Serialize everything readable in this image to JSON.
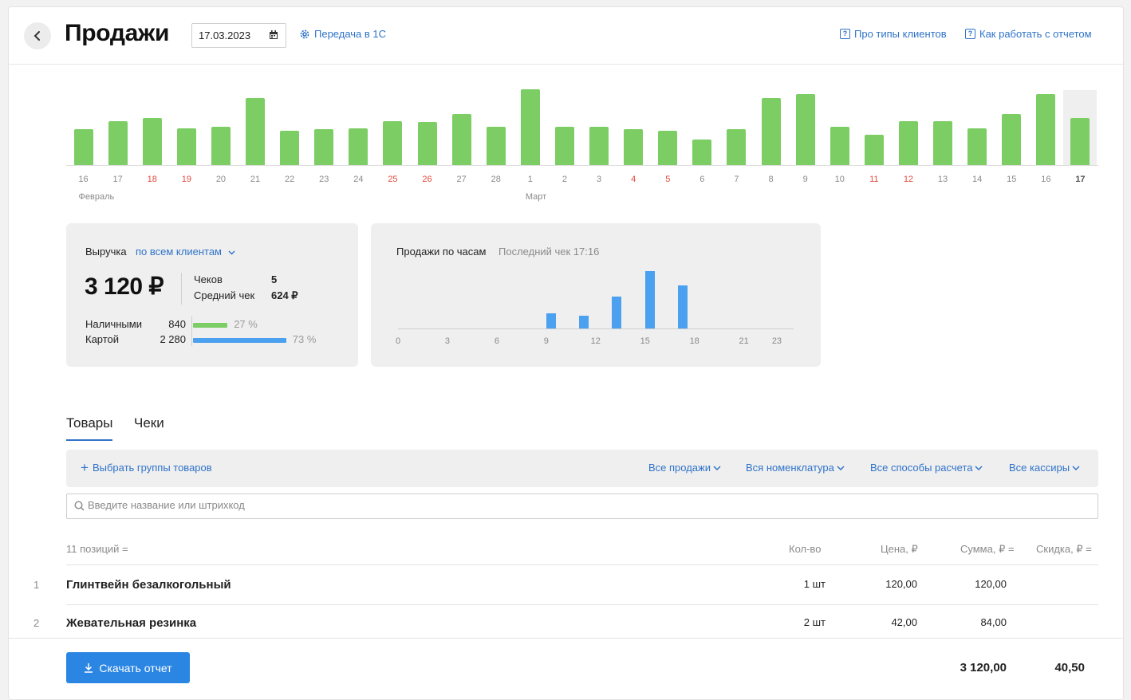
{
  "header": {
    "title": "Продажи",
    "date": "17.03.2023",
    "transfer_link": "Передача в 1С",
    "help_client_types": "Про типы клиентов",
    "help_report": "Как работать с отчетом"
  },
  "day_chart": {
    "chart_data": {
      "type": "bar",
      "categories": [
        "16",
        "17",
        "18",
        "19",
        "20",
        "21",
        "22",
        "23",
        "24",
        "25",
        "26",
        "27",
        "28",
        "1",
        "2",
        "3",
        "4",
        "5",
        "6",
        "7",
        "8",
        "9",
        "10",
        "11",
        "12",
        "13",
        "14",
        "15",
        "16",
        "17"
      ],
      "values": [
        45,
        55,
        59,
        46,
        48,
        84,
        43,
        45,
        46,
        55,
        54,
        64,
        48,
        95,
        48,
        48,
        45,
        43,
        32,
        45,
        84,
        89,
        48,
        38,
        55,
        55,
        46,
        64,
        89,
        59
      ],
      "weekend_flags": [
        false,
        false,
        true,
        true,
        false,
        false,
        false,
        false,
        false,
        true,
        true,
        false,
        false,
        false,
        false,
        false,
        true,
        true,
        false,
        false,
        false,
        false,
        false,
        true,
        true,
        false,
        false,
        false,
        false,
        false
      ],
      "selected_index": 29,
      "months": [
        {
          "label": "Февраль",
          "start_index": 0
        },
        {
          "label": "Март",
          "start_index": 13
        }
      ],
      "bar_color": "#7ccd63",
      "weekend_color": "#e24a3b"
    }
  },
  "revenue": {
    "label": "Выручка",
    "filter": "по всем клиентам",
    "total": "3 120 ₽",
    "checks_label": "Чеков",
    "checks_value": "5",
    "avg_label": "Средний чек",
    "avg_value": "624 ₽",
    "payments": [
      {
        "name": "Наличными",
        "amount": "840",
        "percent": "27 %",
        "fraction": 0.27,
        "color": "#7ccd63"
      },
      {
        "name": "Картой",
        "amount": "2 280",
        "percent": "73 %",
        "fraction": 0.73,
        "color": "#4ba0f0"
      }
    ]
  },
  "hourly": {
    "title": "Продажи по часам",
    "last_check": "Последний чек 17:16",
    "chart_data": {
      "type": "bar",
      "x_ticks": [
        "0",
        "3",
        "6",
        "9",
        "12",
        "15",
        "18",
        "21",
        "23"
      ],
      "hours": [
        9,
        11,
        13,
        15,
        17
      ],
      "values": [
        27,
        22,
        55,
        100,
        75
      ],
      "bar_color": "#4ba0f0"
    }
  },
  "tabs": [
    {
      "label": "Товары",
      "active": true
    },
    {
      "label": "Чеки",
      "active": false
    }
  ],
  "filters": {
    "add_group": "Выбрать группы товаров",
    "all_sales": "Все продажи",
    "all_nomenclature": "Вся номенклатура",
    "all_payment_methods": "Все способы расчета",
    "all_cashiers": "Все кассиры"
  },
  "search": {
    "placeholder": "Введите название или штрихкод"
  },
  "table": {
    "headers": {
      "positions": "11 позиций",
      "qty": "Кол-во",
      "price": "Цена, ₽",
      "sum": "Сумма, ₽",
      "discount": "Скидка, ₽"
    },
    "rows": [
      {
        "num": "1",
        "name": "Глинтвейн безалкогольный",
        "qty": "1 шт",
        "price": "120,00",
        "sum": "120,00",
        "discount": ""
      },
      {
        "num": "2",
        "name": "Жевательная резинка",
        "qty": "2 шт",
        "price": "42,00",
        "sum": "84,00",
        "discount": ""
      }
    ]
  },
  "footer": {
    "download_label": "Скачать отчет",
    "total_sum": "3 120,00",
    "total_discount": "40,50"
  }
}
